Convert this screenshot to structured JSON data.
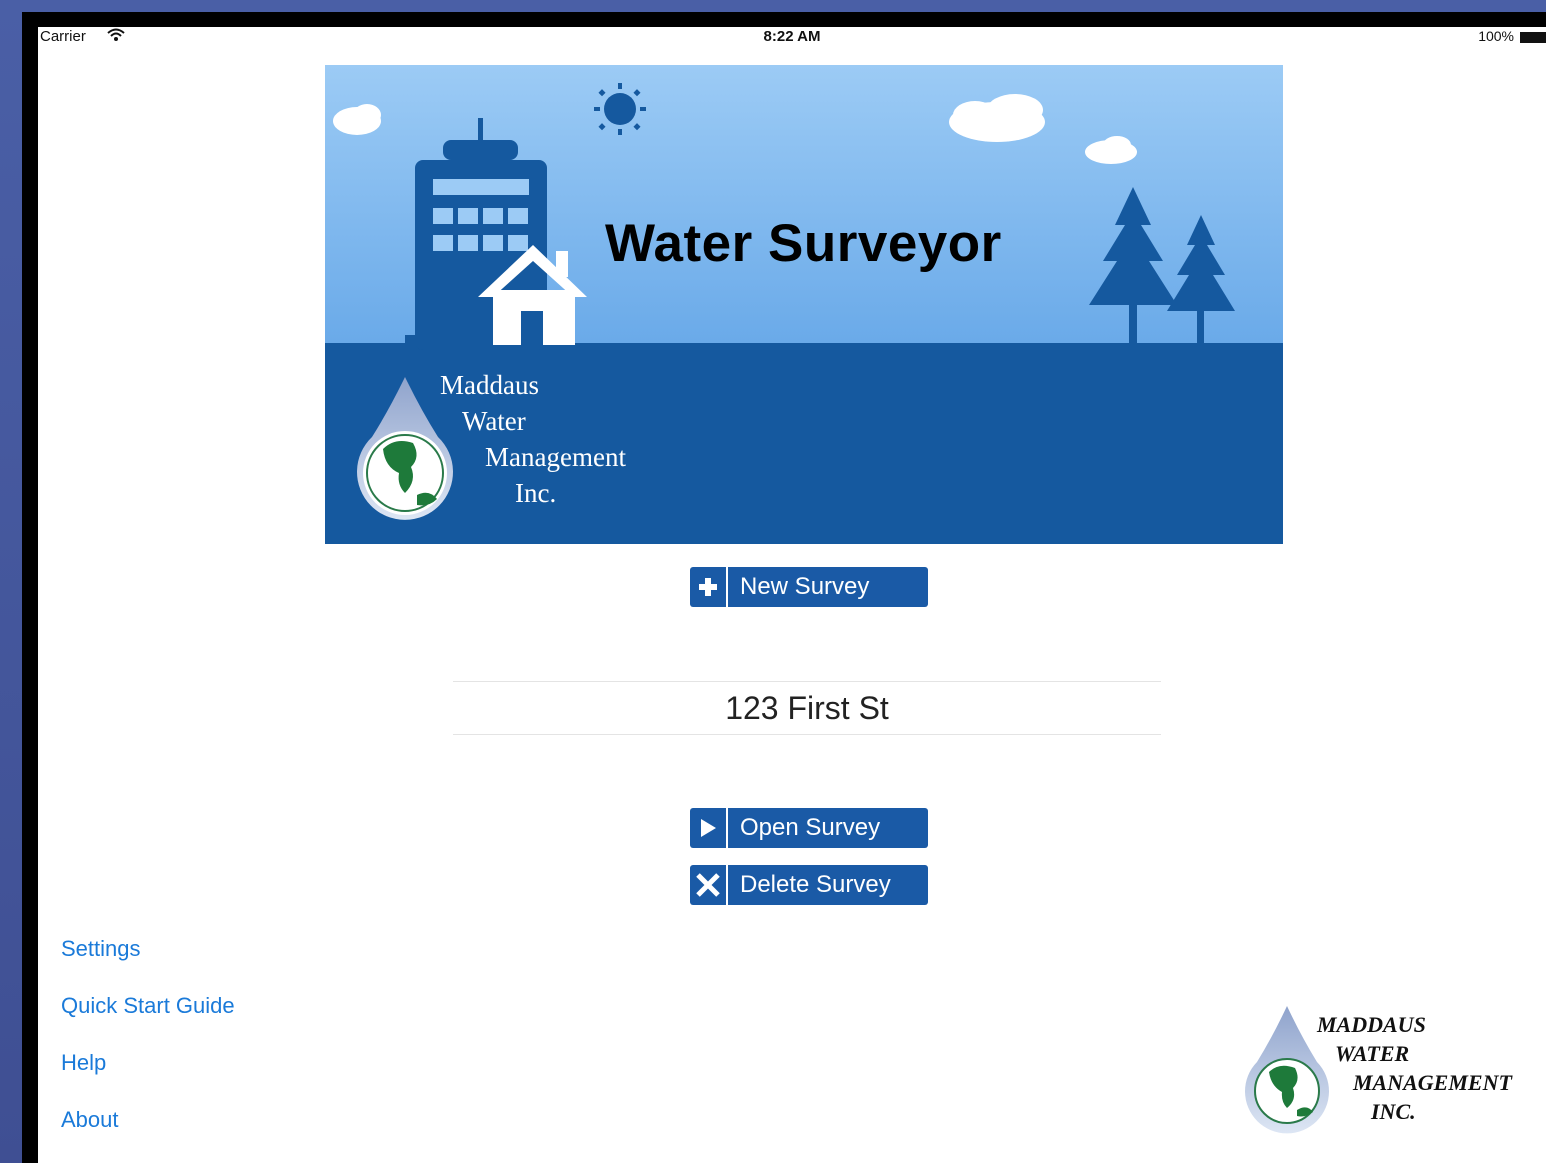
{
  "status_bar": {
    "carrier": "Carrier",
    "time": "8:22 AM",
    "battery": "100%"
  },
  "banner": {
    "title": "Water Surveyor",
    "company_lines": [
      "Maddaus",
      "Water",
      "Management",
      "Inc."
    ]
  },
  "actions": {
    "new_survey": "New Survey",
    "open_survey": "Open Survey",
    "delete_survey": "Delete Survey"
  },
  "survey_list": {
    "selected": "123 First St"
  },
  "menu": {
    "settings": "Settings",
    "quick_start": "Quick Start Guide",
    "help": "Help",
    "about": "About"
  },
  "corner_logo": {
    "lines": [
      "MADDAUS",
      "WATER",
      "MANAGEMENT",
      "INC."
    ]
  },
  "colors": {
    "sky": "#8ec3f2",
    "ground": "#15599f",
    "button": "#1a5aa6",
    "link": "#1a7ad9",
    "frame": "#4a5fa6"
  },
  "icons": {
    "new": "plus-icon",
    "open": "play-icon",
    "delete": "x-icon"
  }
}
